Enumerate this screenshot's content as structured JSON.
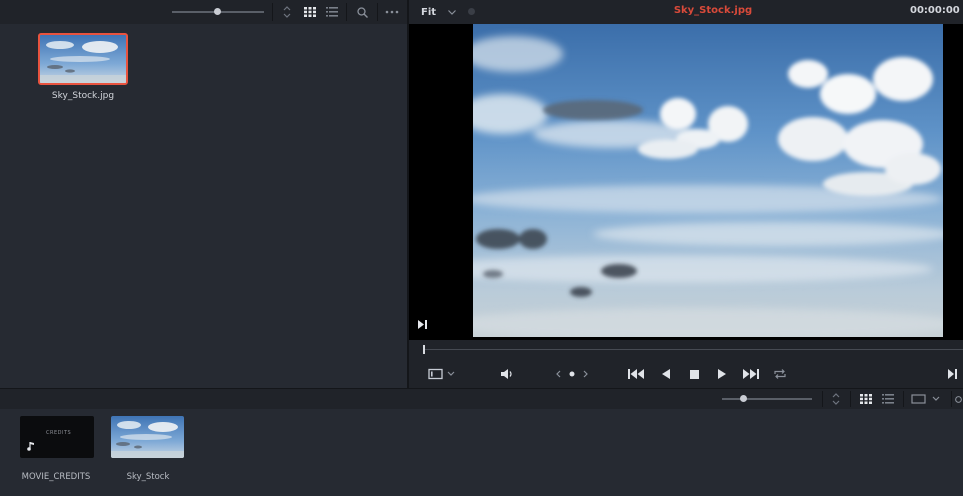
{
  "media_pool": {
    "clip": {
      "name": "Sky_Stock.jpg"
    },
    "thumb_slider_level": 0.5
  },
  "viewer": {
    "zoom": "Fit",
    "clip_title": "Sky_Stock.jpg",
    "timecode": "00:00:00",
    "scrub_position": 0.0
  },
  "timeline_bin": {
    "items": [
      {
        "name": "MOVIE_CREDITS",
        "thumb_text": "CREDITS"
      },
      {
        "name": "Sky_Stock"
      }
    ],
    "thumb_slider_level": 0.25
  },
  "colors": {
    "accent_red": "#e8533f",
    "title_red": "#d94a3a",
    "panel": "#262a32",
    "bar": "#202329"
  }
}
